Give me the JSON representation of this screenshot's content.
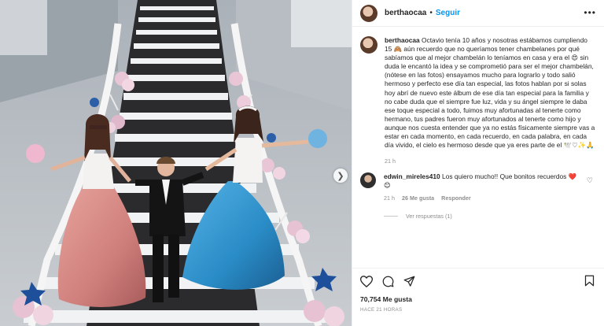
{
  "post": {
    "username": "berthaocaa",
    "follow_label": "Seguir",
    "more_label": "•••",
    "caption_username": "berthaocaa",
    "caption": "Octavio tenía 10 años y nosotras estábamos cumpliendo 15 🙈 aún recuerdo que no queríamos tener chambelanes por qué sabíamos que al mejor chambelán lo teníamos en casa y era el 😍 sin duda le encantó la idea y se comprometió para ser el mejor chambelán,(nótese en las fotos) ensayamos mucho para lograrlo y todo salió hermoso y perfecto ese día tan especial, las fotos hablan por si solas hoy abrí de nuevo este álbum de ese día tan especial para la familia y no cabe duda que el siempre fue luz, vida y su ángel siempre le daba ese toque especial a todo, fuimos muy afortunadas al tenerte como hermano, tus padres fueron muy afortunados al tenerte como hijo y aunque nos cuesta entender que ya no estás físicamente siempre vas a estar en cada momento, en cada recuerdo, en cada palabra, en cada día vivido, el cielo es hermoso desde que ya eres parte de el 🕊️♡✨🙏",
    "caption_time": "21 h",
    "likes": "70,754 Me gusta",
    "timestamp": "HACE 21 HORAS"
  },
  "comment": {
    "username": "edwin_mireles410",
    "text": "Los quiero mucho!! Que bonitos recuerdos ❤️😊",
    "time": "21 h",
    "likes": "26 Me gusta",
    "reply_label": "Responder",
    "view_replies": "Ver respuestas (1)"
  },
  "icons": {
    "like": "heart-icon",
    "comment": "comment-icon",
    "share": "share-icon",
    "save": "bookmark-icon",
    "next": "chevron-right-icon"
  },
  "colors": {
    "accent": "#0095f6",
    "text": "#262626",
    "muted": "#8e8e8e",
    "dress_left": "#d98b86",
    "dress_right": "#2f8fc7"
  }
}
